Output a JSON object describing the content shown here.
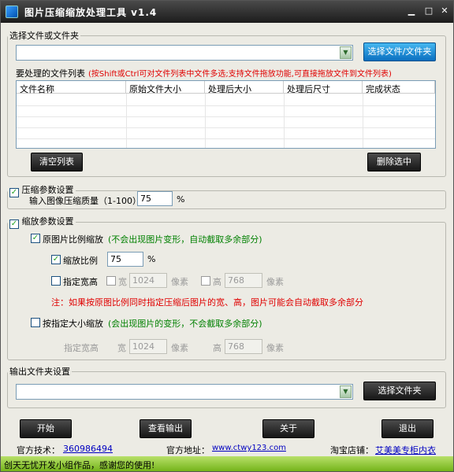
{
  "window": {
    "title": "图片压缩缩放处理工具 v1.4"
  },
  "select_group": {
    "legend": "选择文件或文件夹",
    "path_value": "",
    "choose_button": "选择文件/文件夹",
    "list_label": "要处理的文件列表",
    "list_hint": "(按Shift或Ctrl可对文件列表中文件多选;支持文件拖放功能,可直接拖放文件到文件列表)",
    "columns": [
      "文件名称",
      "原始文件大小",
      "处理后大小",
      "处理后尺寸",
      "完成状态"
    ],
    "clear_button": "清空列表",
    "delete_button": "删除选中"
  },
  "compress_group": {
    "legend": "压缩参数设置",
    "checked": true,
    "quality_label": "输入图像压缩质量（1-100）:",
    "quality_value": "75",
    "percent": "%"
  },
  "scale_group": {
    "legend": "缩放参数设置",
    "checked": true,
    "keep_ratio": {
      "label": "原图片比例缩放",
      "checked": true,
      "hint": "(不会出现图片变形，自动截取多余部分)"
    },
    "scale_ratio": {
      "label": "缩放比例",
      "checked": true,
      "value": "75",
      "unit": "%"
    },
    "custom_size": {
      "label": "指定宽高",
      "checked": false,
      "width_label": "宽",
      "width_value": "1024",
      "height_label": "高",
      "height_value": "768",
      "unit": "像素"
    },
    "note": "注：如果按原图比例同时指定压缩后图片的宽、高，图片可能会自动截取多余部分",
    "exact_size": {
      "label": "按指定大小缩放",
      "checked": false,
      "hint": "(会出现图片的变形，不会截取多余部分)"
    },
    "exact_dims": {
      "label": "指定宽高",
      "width_label": "宽",
      "width_value": "1024",
      "height_label": "高",
      "height_value": "768",
      "unit": "像素"
    }
  },
  "output_group": {
    "legend": "输出文件夹设置",
    "path_value": "",
    "choose_button": "选择文件夹"
  },
  "actions": {
    "start": "开始",
    "view_output": "查看输出",
    "about": "关于",
    "exit": "退出"
  },
  "footer": {
    "support_label": "官方技术：",
    "support_value": "360986494",
    "site_label": "官方地址：",
    "site_value": "www.ctwy123.com",
    "shop_label": "淘宝店铺：",
    "shop_value": "艾美美专柜内衣"
  },
  "status": "创天无忧开发小组作品，感谢您的使用!",
  "colors": {
    "accent_green": "#74b41a",
    "link_blue": "#0000c0",
    "hint_red": "#e00000",
    "hint_green": "#008000"
  }
}
